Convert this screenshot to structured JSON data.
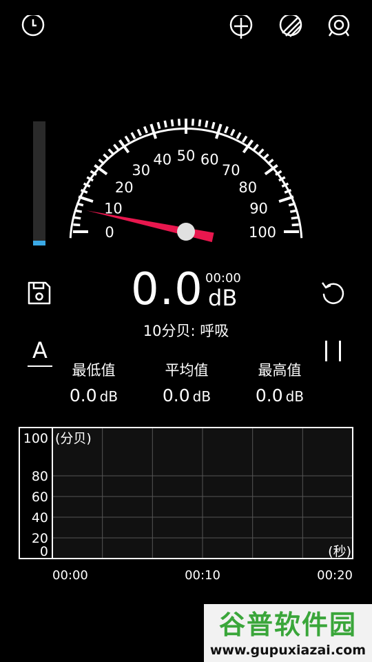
{
  "top_icons": [
    "history-icon",
    "crosshair-icon",
    "theme-icon",
    "settings-icon"
  ],
  "meter": {
    "scale_labels": [
      "0",
      "10",
      "20",
      "30",
      "40",
      "50",
      "60",
      "70",
      "80",
      "90",
      "100"
    ],
    "scale_min": 0,
    "scale_max": 100,
    "needle_value": 0.0,
    "level_fraction": 0.04
  },
  "reading": {
    "value": "0.0",
    "time": "00:00",
    "unit": "dB",
    "description": "10分贝: 呼吸"
  },
  "controls": {
    "font_button": "A"
  },
  "stats": [
    {
      "label": "最低值",
      "value": "0.0",
      "unit": "dB"
    },
    {
      "label": "平均值",
      "value": "0.0",
      "unit": "dB"
    },
    {
      "label": "最高值",
      "value": "0.0",
      "unit": "dB"
    }
  ],
  "chart_data": {
    "type": "line",
    "y_ticks": [
      "100",
      "80",
      "60",
      "40",
      "20",
      "0"
    ],
    "ylabel": "(分贝)",
    "xlabel": "(秒)",
    "x_ticks": [
      "00:00",
      "00:10",
      "00:20"
    ],
    "ylim": [
      0,
      100
    ],
    "series": [
      {
        "values": []
      }
    ],
    "grid": true
  },
  "watermark": {
    "title": "谷普软件园",
    "url": "www.gupuxiazai.com"
  },
  "colors": {
    "background": "#000000",
    "needle": "#e8174e",
    "level_fill": "#3aa9e6",
    "watermark_green": "#3aa63a"
  }
}
